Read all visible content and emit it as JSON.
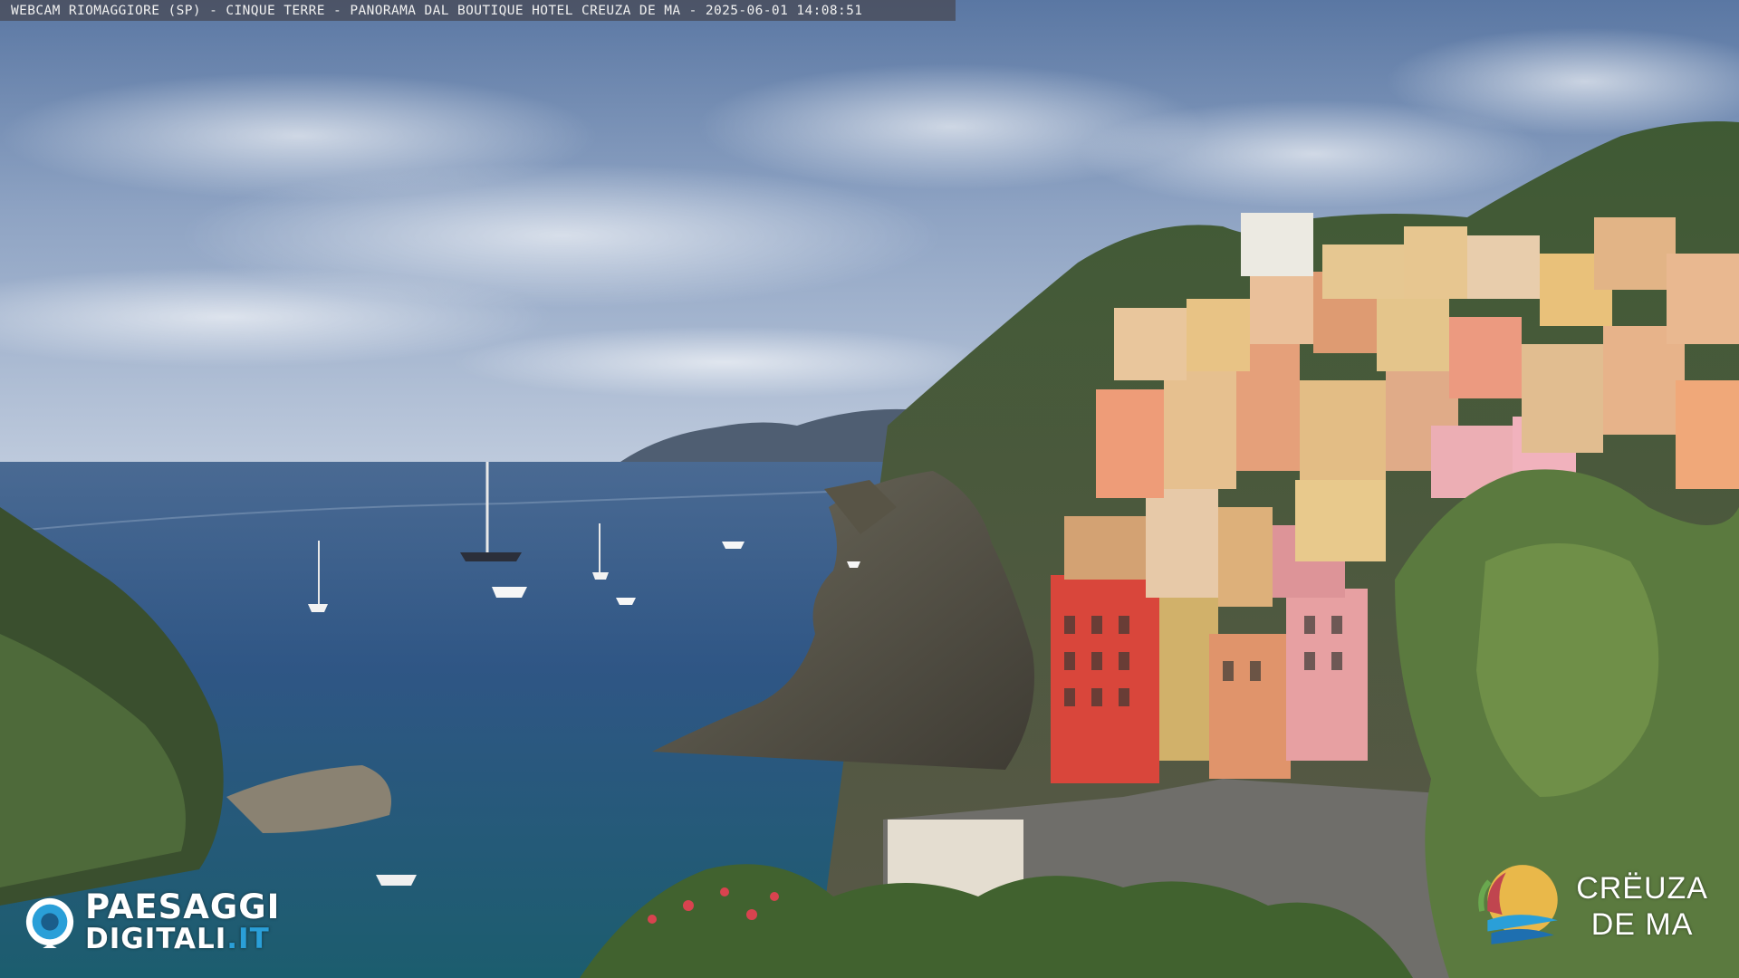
{
  "overlay": {
    "caption": "WEBCAM RIOMAGGIORE (SP) - CINQUE TERRE - PANORAMA DAL BOUTIQUE HOTEL CREUZA DE MA - 2025-06-01 14:08:51"
  },
  "logos": {
    "left": {
      "line1": "PAESAGGI",
      "line2_main": "DIGITALI",
      "line2_suffix": ".IT",
      "icon": "globe-camera-icon"
    },
    "right": {
      "line1": "CRËUZA",
      "line2": "DE MA",
      "icon": "creuza-emblem-icon"
    }
  },
  "colors": {
    "sky_top": "#5f7ca7",
    "sky_horizon": "#b8c6da",
    "sea_deep": "#2f4f75",
    "sea_near": "#1d5f74",
    "cliff": "#5d5a4d",
    "vegetation": "#3c5a2e",
    "brand_blue": "#2a9fd8"
  },
  "scene": {
    "description_icons": [
      "sailboat-icon",
      "motorboat-icon",
      "building-icon",
      "tree-icon",
      "flower-icon"
    ]
  }
}
